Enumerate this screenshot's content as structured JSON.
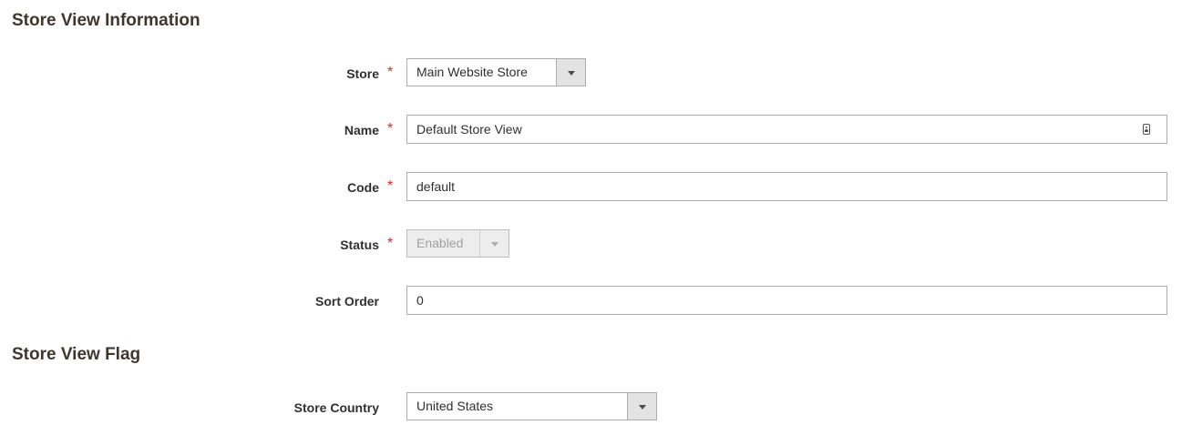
{
  "sections": {
    "info_title": "Store View Information",
    "flag_title": "Store View Flag"
  },
  "fields": {
    "store": {
      "label": "Store",
      "value": "Main Website Store",
      "required": "*"
    },
    "name": {
      "label": "Name",
      "value": "Default Store View",
      "required": "*"
    },
    "code": {
      "label": "Code",
      "value": "default",
      "required": "*"
    },
    "status": {
      "label": "Status",
      "value": "Enabled",
      "required": "*",
      "disabled": true
    },
    "sort_order": {
      "label": "Sort Order",
      "value": "0"
    },
    "store_country": {
      "label": "Store Country",
      "value": "United States"
    }
  },
  "icons": {
    "select_arrow": "chevron-down-icon",
    "name_field_icon": "contact-card-icon"
  },
  "colors": {
    "required": "#e22626",
    "heading": "#41362f",
    "border": "#adadad",
    "arrow_bg": "#e3e3e3"
  }
}
